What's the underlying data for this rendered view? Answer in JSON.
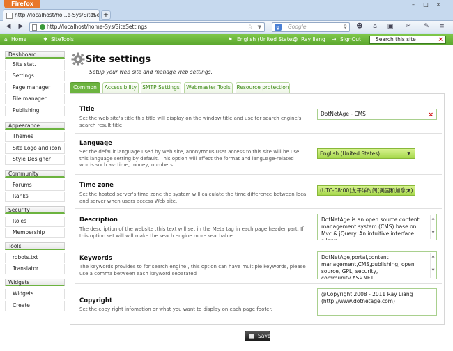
{
  "browser": {
    "app_button": "Firefox",
    "tab_title": "http://localhost/ho...e-Sys/SiteSettings",
    "tab_close": "×",
    "new_tab": "+",
    "window_controls": [
      "–",
      "□",
      "×"
    ],
    "url": "http://localhost/home-Sys/SiteSettings",
    "search_engine": "g",
    "search_placeholder": "Google"
  },
  "site_bar": {
    "home": "Home",
    "sitetools": "SiteTools",
    "language": "English (United States)",
    "user": "Ray liang",
    "signout": "SignOut",
    "search_value": "Search this site",
    "search_clear": "×"
  },
  "sidebar": {
    "sections": [
      {
        "label": "Dashboard",
        "items": [
          "Site stat.",
          "Settings",
          "Page manager",
          "File manager",
          "Publishing"
        ]
      },
      {
        "label": "Appearance",
        "items": [
          "Themes",
          "Site Logo and icon",
          "Style Designer"
        ]
      },
      {
        "label": "Community",
        "items": [
          "Forums",
          "Ranks"
        ]
      },
      {
        "label": "Security",
        "items": [
          "Roles",
          "Membership"
        ]
      },
      {
        "label": "Tools",
        "items": [
          "robots.txt",
          "Translator"
        ]
      },
      {
        "label": "Widgets",
        "items": [
          "Widgets",
          "Create"
        ]
      }
    ]
  },
  "page": {
    "title": "Site settings",
    "subtitle": "Setup your web site and manage web settings."
  },
  "tabs": [
    "Common",
    "Accessibility",
    "SMTP Settings",
    "Webmaster Tools",
    "Resource protection"
  ],
  "settings": {
    "title": {
      "label": "Title",
      "desc": "Set the web site's title,this title will display on the window title and use for search engine's search result title.",
      "value": "DotNetAge - CMS",
      "clear": "×"
    },
    "language": {
      "label": "Language",
      "desc": "Set the default language used by web site, anonymous user access to this site will be use this language setting by default. This option will affect the format and language-related words such as: time, money, numbers.",
      "value": "English (United States)"
    },
    "timezone": {
      "label": "Time zone",
      "desc": "Set the hosted server's time zone the system will calculate the time difference between local and server when users access Web site.",
      "value": "(UTC-08:00)太平洋时间(美国和加拿大)"
    },
    "description": {
      "label": "Description",
      "desc": "The description of the website ,this text will set in the Meta tag in each page header part. If this option set will will make the seach engine more seachable.",
      "value": "DotNetAge is an open source content management system (CMS) base on Mvc & jQuery. An intuitive interface allows"
    },
    "keywords": {
      "label": "Keywords",
      "desc": "The keywords provides to for search engine , this option can have multiple keywords, please use a comma between each keyword separated",
      "value": "DotNetAge,portal,content management,CMS,publishing, open source, GPL, security, community,ASP.NET"
    },
    "copyright": {
      "label": "Copyright",
      "desc": "Set the copy right infomation or what you want to display on each page footer.",
      "line1": "@Copyright 2008 - 2011 Ray Liang",
      "line2": "(http://www.dotnetage.com)"
    }
  },
  "save_label": "Save"
}
